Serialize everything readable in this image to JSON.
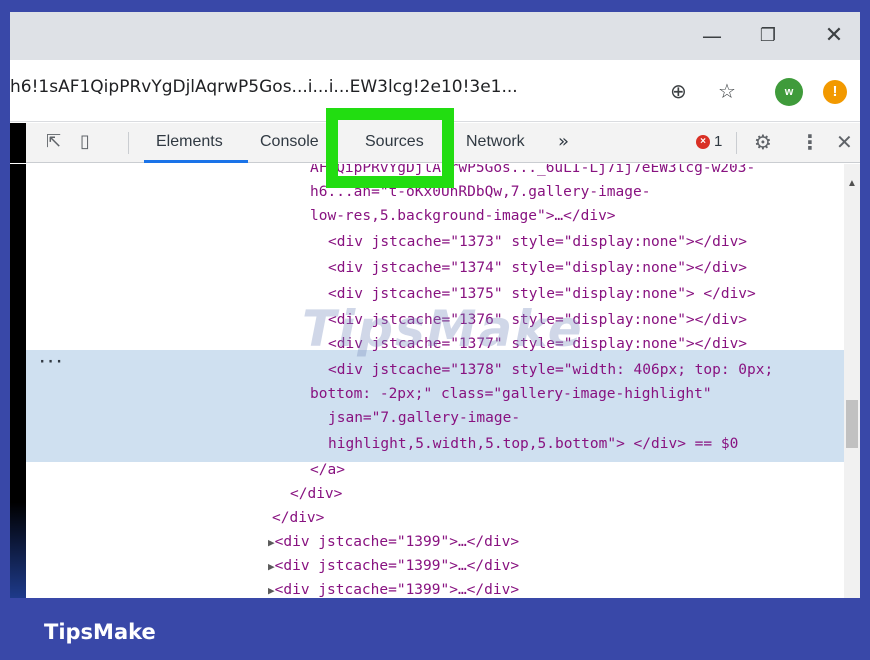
{
  "window": {
    "minimize_icon": "minimize-icon",
    "maximize_icon": "restore-icon",
    "close_icon": "close-icon",
    "min_glyph": "—",
    "max_glyph": "❐",
    "close_glyph": "✕"
  },
  "address_bar": {
    "url": "h6!1sAF1QipPRvYgDjlAqrwP5Gos...i...i...EW3lcg!2e10!3e1...",
    "zoom_glyph": "⊕",
    "star_glyph": "☆",
    "ext_w_label": "w",
    "ext_alert_label": "!"
  },
  "devtools": {
    "inspect_glyph": "⇱",
    "device_glyph": "▯",
    "tabs": [
      {
        "label": "Elements"
      },
      {
        "label": "Console"
      },
      {
        "label": "Sources"
      },
      {
        "label": "Network"
      }
    ],
    "more_tabs": "»",
    "error_count": "1",
    "error_glyph": "×",
    "gear_glyph": "⚙",
    "kebab_glyph": "⋮",
    "close_glyph": "✕",
    "active_tab": "Elements",
    "highlighted_tab": "Sources",
    "highlight_color": "#22dd11"
  },
  "elements_panel": {
    "lines": [
      {
        "text": "AF1QipPRvYgDjlAqrwP5Gos..._6uLI-Lj7ij7eEW3lcg-w203-"
      },
      {
        "text": "h6...an=\"t-oKx0UnRDbQw,7.gallery-image-"
      },
      {
        "text": "low-res,5.background-image\">…</div>"
      },
      {
        "text": "<div jstcache=\"1373\" style=\"display:none\"></div>"
      },
      {
        "text": "<div jstcache=\"1374\" style=\"display:none\"></div>"
      },
      {
        "text": "<div jstcache=\"1375\" style=\"display:none\"> </div>"
      },
      {
        "text": "<div jstcache=\"1376\" style=\"display:none\"></div>"
      },
      {
        "text": "<div jstcache=\"1377\" style=\"display:none\"></div>"
      },
      {
        "text": "<div jstcache=\"1378\" style=\"width: 406px; top: 0px;"
      },
      {
        "text": "bottom: -2px;\" class=\"gallery-image-highlight\""
      },
      {
        "text": "jsan=\"7.gallery-image-"
      },
      {
        "text": "highlight,5.width,5.top,5.bottom\"> </div> == $0"
      },
      {
        "text": "</a>"
      },
      {
        "text": "</div>"
      },
      {
        "text": "</div>"
      },
      {
        "text": "<div jstcache=\"1399\">…</div>"
      },
      {
        "text": "<div jstcache=\"1399\">…</div>"
      },
      {
        "text": "<div jstcache=\"1399\">…</div>"
      }
    ],
    "selected_marker": "···",
    "scroll_up_glyph": "▲"
  },
  "watermark": "TipsMake",
  "brand": "TipsMake"
}
